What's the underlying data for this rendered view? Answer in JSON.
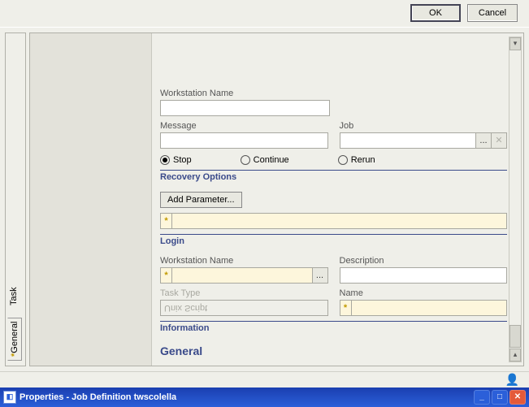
{
  "window": {
    "title": "Properties - Job Definition  twscolella"
  },
  "tabs": {
    "general": "General",
    "task": "Task"
  },
  "page": {
    "heading": "General"
  },
  "sections": {
    "information": "Information",
    "login": "Login",
    "recovery": "Recovery Options"
  },
  "info": {
    "task_type_label": "Task Type",
    "task_type_value": "Unix Script",
    "name_label": "Name",
    "name_value": "",
    "workstation_label": "Workstation Name",
    "workstation_value": "",
    "description_label": "Description",
    "description_value": ""
  },
  "login": {
    "value": "",
    "add_parameter": "Add Parameter..."
  },
  "recovery": {
    "stop": "Stop",
    "continue": "Continue",
    "rerun": "Rerun",
    "message_label": "Message",
    "message_value": "",
    "job_label": "Job",
    "job_value": "",
    "workstation_label": "Workstation Name",
    "workstation_value": ""
  },
  "buttons": {
    "ok": "OK",
    "cancel": "Cancel"
  }
}
